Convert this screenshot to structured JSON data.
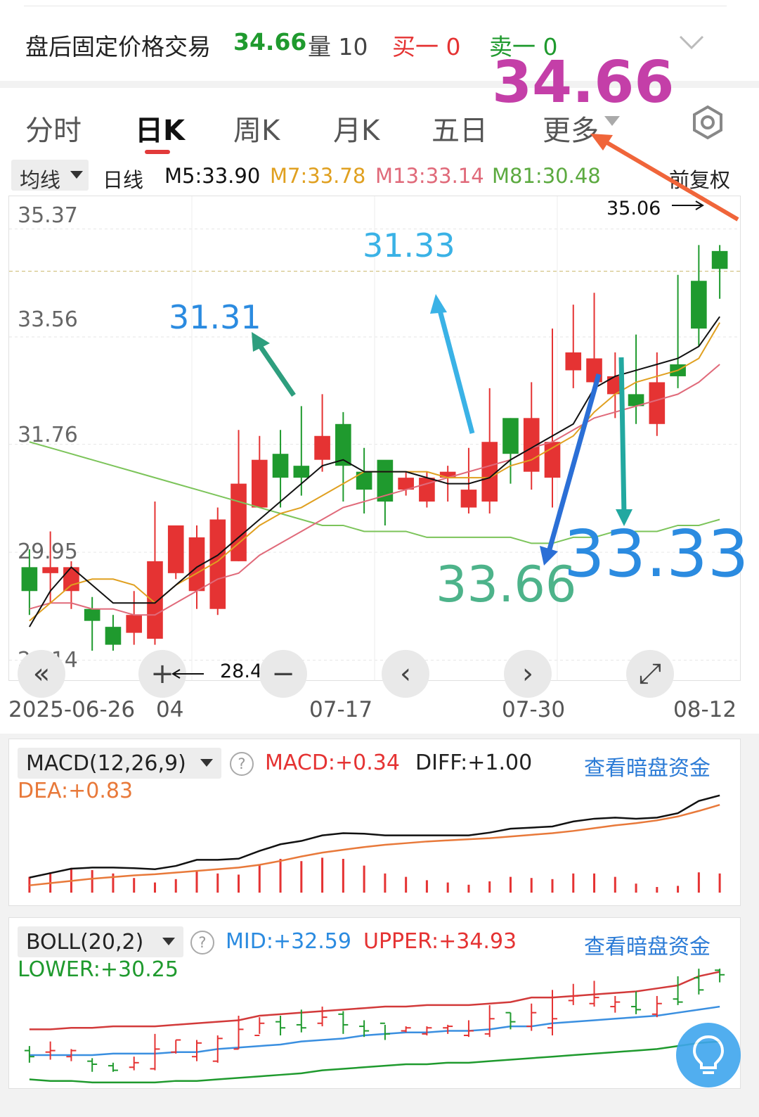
{
  "topbar": {
    "title": "盘后固定价格交易",
    "price": "34.66",
    "vol_label": "量 10",
    "buy1": "买一 0",
    "sell1": "卖一 0"
  },
  "tabs": [
    "分时",
    "日K",
    "周K",
    "月K",
    "五日",
    "更多"
  ],
  "ma_legend": {
    "dropdown": "均线",
    "period": "日线",
    "m5": "M5:33.90",
    "m7": "M7:33.78",
    "m13": "M13:33.14",
    "m81": "M81:30.48",
    "fq": "前复权"
  },
  "yaxis_labels": [
    "35.37",
    "33.56",
    "31.76",
    "29.95",
    "28.14"
  ],
  "xaxis_labels": [
    "2025-06-26",
    "04",
    "07-17",
    "07-30",
    "08-12"
  ],
  "high_marker": "35.06",
  "low_marker": "28.45",
  "controls": [
    "«",
    "+",
    "−",
    "‹",
    "›",
    "⤢"
  ],
  "annotations": {
    "a1": "34.66",
    "a2": "31.33",
    "a3": "31.31",
    "a4": "33.66",
    "a5": "33.33"
  },
  "macd": {
    "name": "MACD(12,26,9)",
    "macd": "MACD:+0.34",
    "diff": "DIFF:+1.00",
    "dea": "DEA:+0.83",
    "link": "查看暗盘资金"
  },
  "boll": {
    "name": "BOLL(20,2)",
    "mid": "MID:+32.59",
    "upper": "UPPER:+34.93",
    "lower": "LOWER:+30.25",
    "link": "查看暗盘资金"
  },
  "colors": {
    "up": "#e53333",
    "down": "#1f9a2e",
    "m5": "#111111",
    "m7": "#e0a020",
    "m13": "#e06a7a",
    "m81": "#7cc45a",
    "magenta": "#c43fa8",
    "blue": "#2b8be0",
    "teal": "#4db38a",
    "link": "#2b7bd6"
  },
  "icons": {
    "collapse": "chevron-down-icon",
    "settings": "hexagon-settings-icon",
    "hint": "lightbulb-icon"
  },
  "chart_data": {
    "type": "candlestick",
    "x": [
      "06-26",
      "06-27",
      "06-30",
      "07-01",
      "07-02",
      "07-03",
      "07-04",
      "07-07",
      "07-08",
      "07-09",
      "07-10",
      "07-11",
      "07-14",
      "07-15",
      "07-16",
      "07-17",
      "07-18",
      "07-21",
      "07-22",
      "07-23",
      "07-24",
      "07-25",
      "07-28",
      "07-29",
      "07-30",
      "07-31",
      "08-01",
      "08-04",
      "08-05",
      "08-06",
      "08-07",
      "08-08",
      "08-11",
      "08-12"
    ],
    "open": [
      29.7,
      29.6,
      29.3,
      29.0,
      28.7,
      28.6,
      28.5,
      29.6,
      29.3,
      29.0,
      29.8,
      30.7,
      31.6,
      31.4,
      31.5,
      32.1,
      31.3,
      31.5,
      31.0,
      30.8,
      31.2,
      30.7,
      30.8,
      32.2,
      31.3,
      31.2,
      33.0,
      32.8,
      32.6,
      32.6,
      32.1,
      33.1,
      34.5,
      35.0
    ],
    "close": [
      29.3,
      29.7,
      29.7,
      28.8,
      28.4,
      28.9,
      29.8,
      30.4,
      30.2,
      30.5,
      31.1,
      31.5,
      31.2,
      31.2,
      31.9,
      31.4,
      31.0,
      30.8,
      31.2,
      31.2,
      31.3,
      31.0,
      31.8,
      31.6,
      32.2,
      31.8,
      33.3,
      33.2,
      32.9,
      32.4,
      32.8,
      32.9,
      33.7,
      34.7
    ],
    "high": [
      30.0,
      30.3,
      29.8,
      29.2,
      28.9,
      29.3,
      30.8,
      30.4,
      30.4,
      30.7,
      32.0,
      31.9,
      32.0,
      32.4,
      32.6,
      32.3,
      31.7,
      31.4,
      31.3,
      31.3,
      31.4,
      31.7,
      32.7,
      32.2,
      32.8,
      33.7,
      34.1,
      34.3,
      33.3,
      33.6,
      33.3,
      34.6,
      35.1,
      35.1
    ],
    "low": [
      28.9,
      29.1,
      29.0,
      28.3,
      28.3,
      28.4,
      28.4,
      29.5,
      29.0,
      28.9,
      29.8,
      30.8,
      30.7,
      30.9,
      31.3,
      30.8,
      30.6,
      30.4,
      30.9,
      30.7,
      30.8,
      30.6,
      30.6,
      31.1,
      31.0,
      30.7,
      32.7,
      32.6,
      32.2,
      32.1,
      31.9,
      32.7,
      33.4,
      34.2
    ],
    "m5": [
      28.7,
      29.3,
      29.7,
      29.4,
      29.1,
      29.1,
      29.1,
      29.4,
      29.7,
      29.9,
      30.2,
      30.5,
      30.8,
      31.1,
      31.4,
      31.5,
      31.3,
      31.3,
      31.3,
      31.2,
      31.1,
      31.1,
      31.2,
      31.5,
      31.7,
      31.9,
      32.1,
      32.7,
      32.9,
      33.0,
      33.1,
      33.2,
      33.4,
      33.9
    ],
    "m7": [
      28.8,
      29.1,
      29.4,
      29.5,
      29.5,
      29.4,
      29.1,
      29.4,
      29.6,
      29.8,
      30.1,
      30.4,
      30.6,
      30.7,
      30.9,
      31.1,
      31.3,
      31.3,
      31.3,
      31.3,
      31.2,
      31.2,
      31.2,
      31.4,
      31.5,
      31.7,
      31.9,
      32.3,
      32.6,
      32.8,
      32.9,
      33.0,
      33.2,
      33.8
    ],
    "m13": [
      29.0,
      29.1,
      29.1,
      29.0,
      29.0,
      28.9,
      28.9,
      29.1,
      29.3,
      29.5,
      29.6,
      29.9,
      30.1,
      30.3,
      30.5,
      30.7,
      30.8,
      30.9,
      31.0,
      31.1,
      31.2,
      31.3,
      31.4,
      31.5,
      31.7,
      31.8,
      32.0,
      32.2,
      32.3,
      32.4,
      32.5,
      32.6,
      32.8,
      33.1
    ],
    "m81": [
      31.8,
      31.7,
      31.6,
      31.5,
      31.4,
      31.3,
      31.2,
      31.1,
      31.0,
      30.9,
      30.8,
      30.7,
      30.6,
      30.5,
      30.4,
      30.4,
      30.3,
      30.3,
      30.3,
      30.2,
      30.2,
      30.2,
      30.2,
      30.2,
      30.1,
      30.1,
      30.2,
      30.2,
      30.3,
      30.3,
      30.3,
      30.4,
      30.4,
      30.5
    ],
    "ylim": [
      27.9,
      35.8
    ]
  },
  "macd_data": {
    "diff": [
      -0.48,
      -0.4,
      -0.32,
      -0.3,
      -0.3,
      -0.31,
      -0.33,
      -0.27,
      -0.16,
      -0.16,
      -0.14,
      0.0,
      0.12,
      0.18,
      0.28,
      0.32,
      0.31,
      0.28,
      0.28,
      0.28,
      0.28,
      0.28,
      0.33,
      0.4,
      0.42,
      0.44,
      0.53,
      0.58,
      0.6,
      0.58,
      0.6,
      0.68,
      0.9,
      1.0
    ],
    "dea": [
      -0.62,
      -0.58,
      -0.54,
      -0.5,
      -0.47,
      -0.44,
      -0.42,
      -0.39,
      -0.36,
      -0.33,
      -0.3,
      -0.25,
      -0.18,
      -0.1,
      -0.03,
      0.02,
      0.07,
      0.11,
      0.14,
      0.17,
      0.19,
      0.21,
      0.23,
      0.26,
      0.29,
      0.32,
      0.36,
      0.41,
      0.46,
      0.5,
      0.55,
      0.62,
      0.72,
      0.83
    ],
    "macd": [
      0.28,
      0.36,
      0.44,
      0.4,
      0.34,
      0.26,
      0.18,
      0.24,
      0.4,
      0.34,
      0.32,
      0.5,
      0.6,
      0.56,
      0.62,
      0.6,
      0.48,
      0.34,
      0.28,
      0.22,
      0.18,
      0.14,
      0.2,
      0.28,
      0.26,
      0.24,
      0.34,
      0.34,
      0.28,
      0.16,
      0.1,
      0.12,
      0.36,
      0.34
    ]
  },
  "boll_data": {
    "upper": [
      31.1,
      31.1,
      31.2,
      31.2,
      31.3,
      31.3,
      31.3,
      31.4,
      31.5,
      31.6,
      31.7,
      32.0,
      32.1,
      32.2,
      32.3,
      32.4,
      32.5,
      32.6,
      32.6,
      32.7,
      32.7,
      32.7,
      32.8,
      32.9,
      33.2,
      33.2,
      33.3,
      33.4,
      33.5,
      33.6,
      33.8,
      34.0,
      34.6,
      34.9
    ],
    "mid": [
      29.4,
      29.4,
      29.4,
      29.4,
      29.5,
      29.5,
      29.5,
      29.6,
      29.6,
      29.8,
      29.9,
      30.0,
      30.1,
      30.3,
      30.4,
      30.5,
      30.7,
      30.8,
      30.9,
      30.9,
      31.0,
      31.0,
      31.1,
      31.3,
      31.3,
      31.5,
      31.6,
      31.7,
      31.8,
      31.9,
      32.0,
      32.2,
      32.4,
      32.6
    ],
    "lower": [
      27.8,
      27.7,
      27.7,
      27.6,
      27.6,
      27.6,
      27.6,
      27.7,
      27.7,
      27.8,
      27.9,
      28.0,
      28.1,
      28.2,
      28.4,
      28.5,
      28.6,
      28.7,
      28.8,
      28.8,
      28.9,
      28.9,
      29.0,
      29.1,
      29.2,
      29.3,
      29.4,
      29.5,
      29.6,
      29.7,
      29.8,
      30.0,
      30.2,
      30.3
    ],
    "ylim": [
      27.5,
      35.2
    ]
  }
}
